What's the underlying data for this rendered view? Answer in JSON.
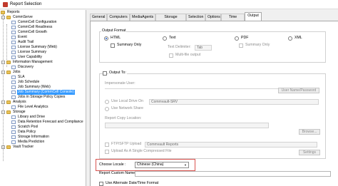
{
  "window": {
    "title": "Report Selection"
  },
  "tree": {
    "items": [
      {
        "label": "Reports"
      },
      {
        "label": "CommServe"
      },
      {
        "label": "CommCell Configuration"
      },
      {
        "label": "CommCell Readiness"
      },
      {
        "label": "CommCell Growth"
      },
      {
        "label": "Event"
      },
      {
        "label": "Audit Trail"
      },
      {
        "label": "License Summary (Web)"
      },
      {
        "label": "License Summary"
      },
      {
        "label": "User Capability"
      },
      {
        "label": "Information Management"
      },
      {
        "label": "Discovery"
      },
      {
        "label": "Jobs"
      },
      {
        "label": "SLA"
      },
      {
        "label": "Job Schedule"
      },
      {
        "label": "Job Summary (Web)"
      },
      {
        "label": "Job Summary (CommCell Console)"
      },
      {
        "label": "Jobs in Storage Policy Copies"
      },
      {
        "label": "Analysis"
      },
      {
        "label": "File Level Analytics"
      },
      {
        "label": "Storage"
      },
      {
        "label": "Library and Drive"
      },
      {
        "label": "Data Retention Forecast and Compliance"
      },
      {
        "label": "Scratch Pool"
      },
      {
        "label": "Data Policy"
      },
      {
        "label": "Storage Information"
      },
      {
        "label": "Media Prediction"
      },
      {
        "label": "Vault Tracker"
      }
    ]
  },
  "tabs": [
    "General",
    "Computers",
    "MediaAgents",
    "Storage Policies",
    "Selection",
    "Options",
    "Time Range",
    "Output"
  ],
  "output": {
    "output_format_label": "Output Format",
    "html_label": "HTML",
    "text_label": "Text",
    "pdf_label": "PDF",
    "xml_label": "XML",
    "summary_only_label": "Summary Only",
    "summary_only_pdf_label": "Summary Only",
    "text_delimiter_label": "Text Delimiter:",
    "text_delimiter_value": "Tab",
    "multi_file_label": "Multi-file output",
    "output_to_label": "Output To:",
    "impersonate_label": "Impersonate User:",
    "user_name_button": "User Name/Password",
    "use_local_drive_label": "Use Local Drive On",
    "local_drive_value": "Commvault-SRV",
    "use_network_share_label": "Use Network Share",
    "report_copy_location_label": "Report Copy Location:",
    "browse_button": "Browse...",
    "ftp_label": "FTP/SFTP Upload",
    "ftp_value": "Commvault Reports",
    "upload_compressed_label": "Upload As A Single Compressed File",
    "settings_button": "Settings",
    "choose_locale_label": "Choose Locale :",
    "locale_value": "Chinese (China)",
    "report_custom_name_label": "Report Custom Name:",
    "alternate_date_label": "Use Alternate Date/Time Format"
  },
  "colors": {
    "selection": "#3399ff",
    "highlight_box": "#d9534f"
  }
}
